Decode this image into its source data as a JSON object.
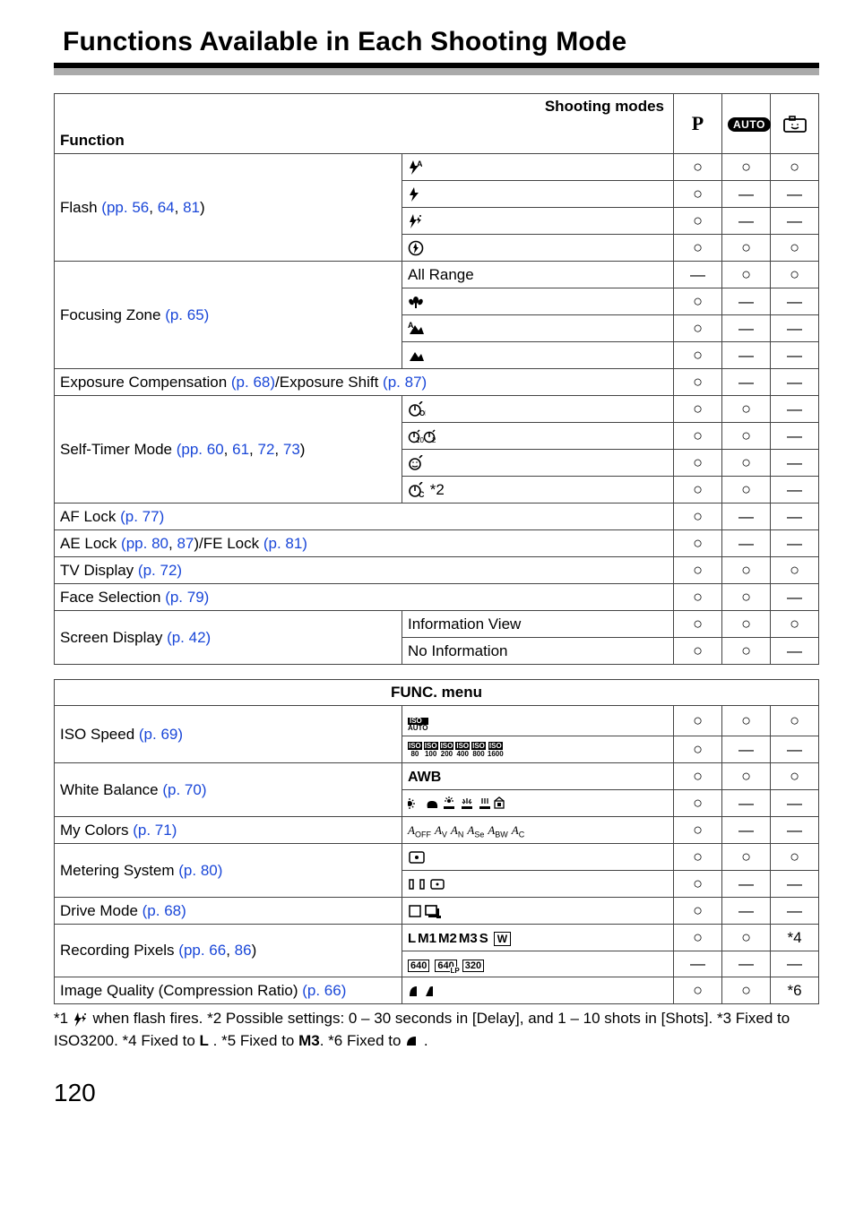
{
  "title": "Functions Available in Each Shooting Mode",
  "page_number": "120",
  "header_shooting_modes": "Shooting modes",
  "header_function": "Function",
  "modes": {
    "p": "P",
    "auto": "AUTO"
  },
  "marks": {
    "yes": "○",
    "no": "—",
    "star4": "*4",
    "star6": "*6"
  },
  "table1": {
    "rows": [
      {
        "label_parts": [
          "Flash ",
          "(pp. 56",
          ", ",
          "64",
          ",  ",
          "81",
          ")"
        ],
        "subs": [
          {
            "icon": "flash-auto",
            "vals": [
              "yes",
              "yes",
              "yes"
            ]
          },
          {
            "icon": "flash-on",
            "vals": [
              "yes",
              "no",
              "no"
            ]
          },
          {
            "icon": "flash-slow",
            "vals": [
              "yes",
              "no",
              "no"
            ]
          },
          {
            "icon": "flash-off",
            "vals": [
              "yes",
              "yes",
              "yes"
            ]
          }
        ]
      },
      {
        "label_parts": [
          "Focusing Zone ",
          "(p. 65)"
        ],
        "subs": [
          {
            "text": "All Range",
            "vals": [
              "no",
              "yes",
              "yes"
            ]
          },
          {
            "icon": "macro",
            "vals": [
              "yes",
              "no",
              "no"
            ]
          },
          {
            "icon": "mountain-a",
            "vals": [
              "yes",
              "no",
              "no"
            ]
          },
          {
            "icon": "mountain",
            "vals": [
              "yes",
              "no",
              "no"
            ]
          }
        ]
      },
      {
        "label_full_parts": [
          "Exposure Compensation ",
          "(p. 68)",
          "/Exposure Shift ",
          "(p. 87)"
        ],
        "vals": [
          "yes",
          "no",
          "no"
        ]
      },
      {
        "label_parts": [
          "Self-Timer Mode ",
          "(pp. 60",
          ", ",
          "61",
          ", ",
          "72",
          ",  ",
          "73",
          ")"
        ],
        "subs": [
          {
            "icon": "timer-off",
            "vals": [
              "yes",
              "yes",
              "no"
            ]
          },
          {
            "icon": "timer-10-2",
            "vals": [
              "yes",
              "yes",
              "no"
            ]
          },
          {
            "icon": "timer-face",
            "vals": [
              "yes",
              "yes",
              "no"
            ]
          },
          {
            "icon": "timer-custom",
            "suffix": " *2",
            "vals": [
              "yes",
              "yes",
              "no"
            ]
          }
        ]
      },
      {
        "label_full_parts": [
          "AF Lock ",
          "(p. 77)"
        ],
        "vals": [
          "yes",
          "no",
          "no"
        ]
      },
      {
        "label_full_parts": [
          "AE Lock ",
          "(pp. 80",
          ",  ",
          "87",
          ")",
          "/FE Lock ",
          "(p. 81)"
        ],
        "vals": [
          "yes",
          "no",
          "no"
        ]
      },
      {
        "label_full_parts": [
          "TV Display ",
          "(p. 72)"
        ],
        "vals": [
          "yes",
          "yes",
          "yes"
        ]
      },
      {
        "label_full_parts": [
          "Face Selection ",
          "(p. 79)"
        ],
        "vals": [
          "yes",
          "yes",
          "no"
        ]
      },
      {
        "label_parts": [
          "Screen Display ",
          "(p. 42)"
        ],
        "subs": [
          {
            "text": "Information View",
            "vals": [
              "yes",
              "yes",
              "yes"
            ]
          },
          {
            "text": "No Information",
            "vals": [
              "yes",
              "yes",
              "no"
            ]
          }
        ]
      }
    ]
  },
  "func_menu_header": "FUNC. menu",
  "table2": {
    "rows": [
      {
        "label_parts": [
          "ISO Speed ",
          "(p. 69)"
        ],
        "subs": [
          {
            "icon": "iso-auto",
            "vals": [
              "yes",
              "yes",
              "yes"
            ]
          },
          {
            "icon": "iso-list",
            "vals": [
              "yes",
              "no",
              "no"
            ]
          }
        ]
      },
      {
        "label_parts": [
          "White Balance ",
          "(p. 70)"
        ],
        "subs": [
          {
            "text_bold": "AWB",
            "vals": [
              "yes",
              "yes",
              "yes"
            ]
          },
          {
            "icon": "wb-presets",
            "vals": [
              "yes",
              "no",
              "no"
            ]
          }
        ]
      },
      {
        "label_full_parts": [
          "My Colors ",
          "(p. 71)"
        ],
        "opt_icon": "mycolors",
        "vals": [
          "yes",
          "no",
          "no"
        ]
      },
      {
        "label_parts": [
          "Metering System ",
          "(p. 80)"
        ],
        "subs": [
          {
            "icon": "meter-eval",
            "vals": [
              "yes",
              "yes",
              "yes"
            ]
          },
          {
            "icon": "meter-other",
            "vals": [
              "yes",
              "no",
              "no"
            ]
          }
        ]
      },
      {
        "label_full_parts": [
          "Drive Mode ",
          "(p. 68)"
        ],
        "opt_icon": "drive",
        "vals": [
          "yes",
          "no",
          "no"
        ]
      },
      {
        "label_parts": [
          "Recording Pixels ",
          "(pp. 66",
          ",  ",
          "86",
          ")"
        ],
        "subs": [
          {
            "icon": "rec-pixels",
            "vals": [
              "yes",
              "yes",
              "star4"
            ]
          },
          {
            "icon": "movie-res",
            "vals": [
              "no",
              "no",
              "no"
            ]
          }
        ]
      },
      {
        "label_full_parts": [
          "Image Quality (Compression Ratio) ",
          "(p. 66)"
        ],
        "opt_icon": "quality",
        "vals": [
          "yes",
          "yes",
          "star6"
        ]
      }
    ]
  },
  "footnotes_parts": [
    "*1 ",
    "{flash-slow}",
    " when flash fires. *2 Possible settings: 0 – 30 seconds in [Delay], and 1 – 10 shots in [Shots]. *3 Fixed to ISO3200. *4 Fixed to  ",
    "{L}",
    " . *5 Fixed to ",
    "{M3}",
    ". *6 Fixed to ",
    "{qual}",
    " ."
  ],
  "iso_list_items": [
    {
      "top": "ISO",
      "bot": "80"
    },
    {
      "top": "ISO",
      "bot": "100"
    },
    {
      "top": "ISO",
      "bot": "200"
    },
    {
      "top": "ISO",
      "bot": "400"
    },
    {
      "top": "ISO",
      "bot": "800"
    },
    {
      "top": "ISO",
      "bot": "1600"
    }
  ],
  "mycolors_labels": [
    "OFF",
    "V",
    "N",
    "Se",
    "BW",
    "C"
  ],
  "rec_pixels_labels": [
    "L",
    "M1",
    "M2",
    "M3",
    "S",
    "W"
  ]
}
